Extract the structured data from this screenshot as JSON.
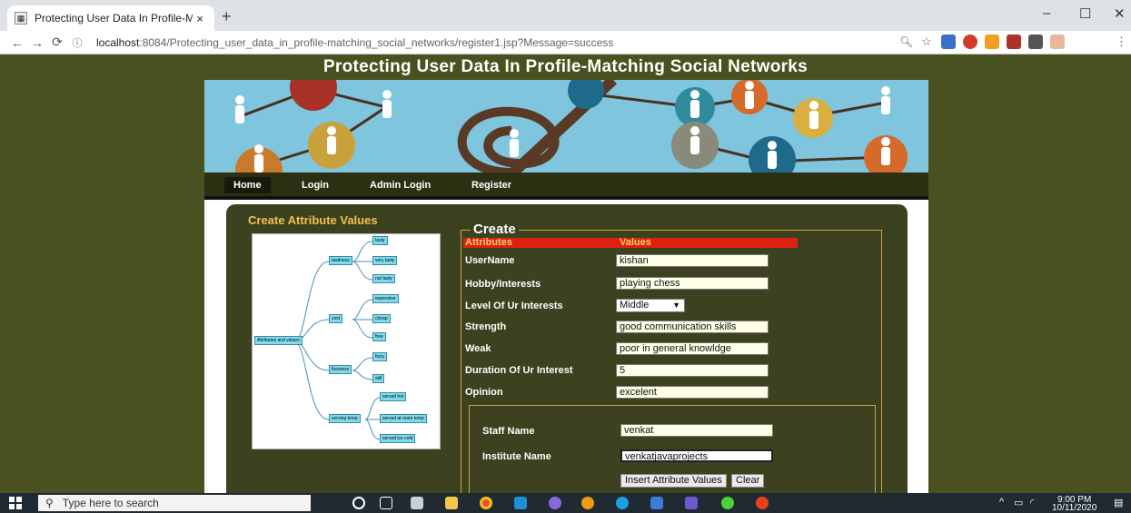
{
  "browser": {
    "tab_title": "Protecting User Data In Profile-M",
    "tab_close": "×",
    "new_tab": "+",
    "url_host": "localhost",
    "url_rest": ":8084/Protecting_user_data_in_profile-matching_social_networks/register1.jsp?Message=success",
    "window_controls": [
      "–",
      "☐",
      "✕"
    ]
  },
  "page": {
    "heading": "Protecting User Data In Profile-Matching Social Networks",
    "nav": [
      "Home",
      "Login",
      "Admin Login",
      "Register"
    ],
    "section_title": "Create Attribute Values"
  },
  "diagram": {
    "root": "Attributes and values",
    "branches": [
      {
        "label": "tastiness",
        "leaves": [
          "tasty",
          "very tasty",
          "not tasty"
        ]
      },
      {
        "label": "cost",
        "leaves": [
          "expensive",
          "cheap",
          "free"
        ]
      },
      {
        "label": "fizziness",
        "leaves": [
          "fizzy",
          "still"
        ]
      },
      {
        "label": "serving temp",
        "leaves": [
          "served hot",
          "served at room temp",
          "served ice cold"
        ]
      }
    ]
  },
  "form": {
    "legend": "Create",
    "col_attributes": "Attributes",
    "col_values": "Values",
    "fields": [
      {
        "label": "UserName",
        "value": "kishan"
      },
      {
        "label": "Hobby/Interests",
        "value": "playing chess"
      },
      {
        "label": "Level Of Ur Interests",
        "value": "Middle",
        "type": "select"
      },
      {
        "label": "Strength",
        "value": "good communication skills"
      },
      {
        "label": "Weak",
        "value": "poor in general knowldge"
      },
      {
        "label": "Duration Of Ur Interest",
        "value": "5"
      },
      {
        "label": "Opinion",
        "value": "excelent"
      }
    ],
    "staff_label": "Staff Name",
    "staff_value": "venkat",
    "institute_label": "Institute Name",
    "institute_value": "venkatjavaprojects",
    "insert_button": "Insert Attribute Values",
    "clear_button": "Clear"
  },
  "taskbar": {
    "search_placeholder": "Type here to search",
    "time": "9:00 PM",
    "date": "10/11/2020"
  }
}
